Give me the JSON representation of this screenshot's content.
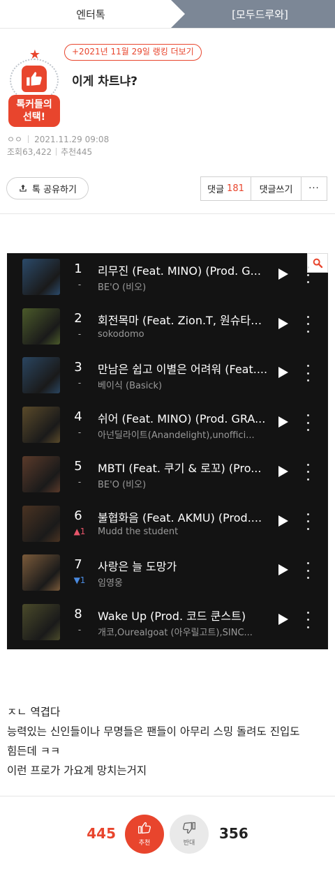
{
  "nav": {
    "left_tab": "엔터톡",
    "right_tab": "[모두드루와]"
  },
  "badge": {
    "label_line1": "톡커들의",
    "label_line2": "선택!"
  },
  "ranking_link": "+2021년 11월 29일 랭킹 더보기",
  "post": {
    "title": "이게 차트냐?",
    "author": "ㅇㅇ",
    "date": "2021.11.29 09:08",
    "views_label": "조회",
    "views": "63,422",
    "recommend_label": "추천",
    "recommend": "445"
  },
  "actions": {
    "share": "톡 공유하기",
    "comments_label": "댓글",
    "comments_count": "181",
    "write_comment": "댓글쓰기",
    "more": "···"
  },
  "chart": {
    "rows": [
      {
        "rank": "1",
        "change": "-",
        "title": "리무진 (Feat. MINO) (Prod. G...",
        "artist": "BE'O (비오)",
        "art_color": "#2b4a6a"
      },
      {
        "rank": "2",
        "change": "-",
        "title": "회전목마 (Feat. Zion.T, 원슈타…",
        "artist": "sokodomo",
        "art_color": "#4b5a2a"
      },
      {
        "rank": "3",
        "change": "-",
        "title": "만남은 쉽고 이별은 어려워 (Feat....",
        "artist": "베이식 (Basick)",
        "art_color": "#2a4560"
      },
      {
        "rank": "4",
        "change": "-",
        "title": "쉬어 (Feat. MINO) (Prod. GRA...",
        "artist": "아넌딜라이트(Anandelight),unoffici...",
        "art_color": "#5a4a2a"
      },
      {
        "rank": "5",
        "change": "-",
        "title": "MBTI (Feat. 쿠기 & 로꼬) (Pro...",
        "artist": "BE'O (비오)",
        "art_color": "#5a3a2a"
      },
      {
        "rank": "6",
        "change": "▲1",
        "change_color": "#e8556a",
        "title": "불협화음 (Feat. AKMU) (Prod....",
        "artist": "Mudd the student",
        "art_color": "#4a3322"
      },
      {
        "rank": "7",
        "change": "▼1",
        "change_color": "#4a8ae0",
        "title": "사랑은 늘 도망가",
        "artist": "임영웅",
        "art_color": "#7a5a3a"
      },
      {
        "rank": "8",
        "change": "-",
        "title": "Wake Up (Prod. 코드 쿤스트)",
        "artist": "개코,Ourealgoat (아우릴고트),SINC...",
        "art_color": "#4a4a2a"
      }
    ]
  },
  "body": {
    "line1": "ㅈㄴ 역겹다",
    "line2": "능력있는 신인들이나 무명들은 팬들이 아무리 스밍 돌려도 진입도",
    "line3": "힘든데 ㅋㅋ",
    "line4": "이런 프로가 가요계 망치는거지"
  },
  "votes": {
    "up_count": "445",
    "up_label": "추천",
    "down_label": "반대",
    "down_count": "356"
  }
}
